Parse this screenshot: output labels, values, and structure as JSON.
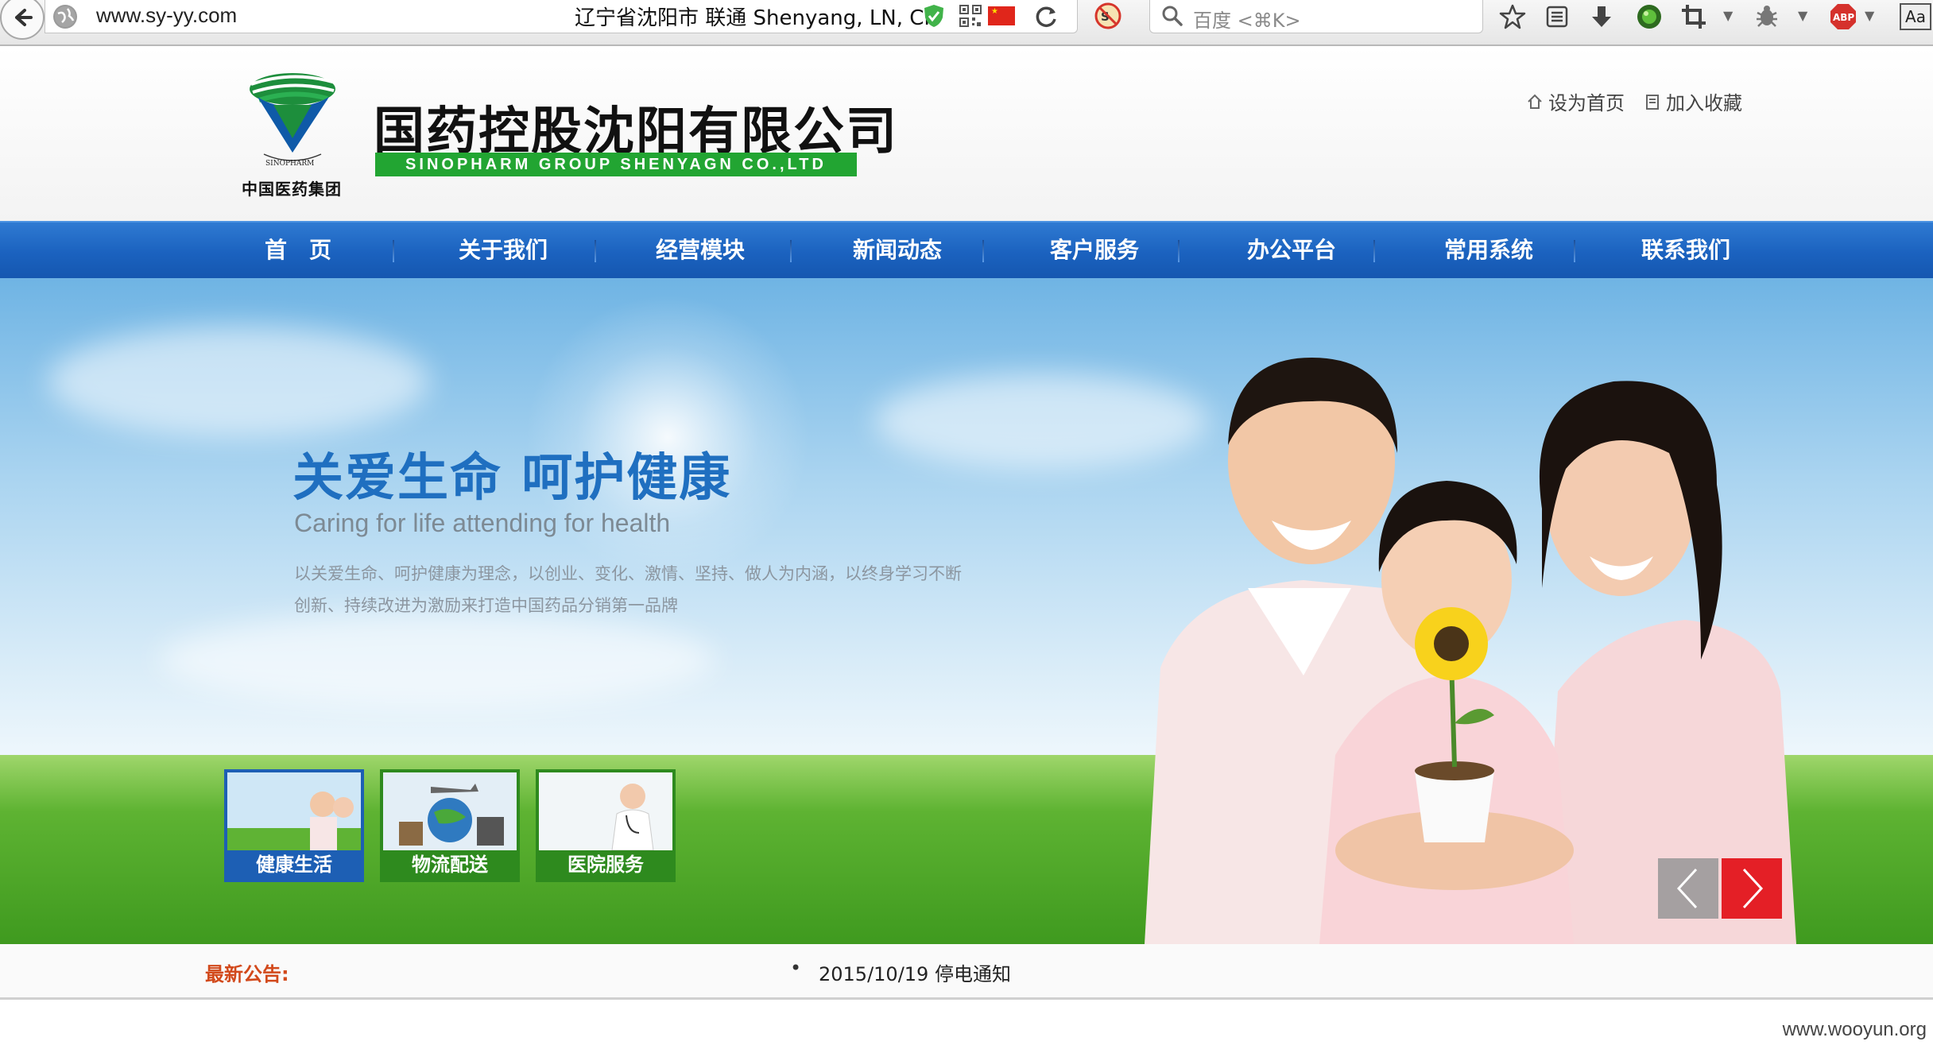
{
  "browser": {
    "url": "www.sy-yy.com",
    "geo_info": "辽宁省沈阳市 联通   Shenyang, LN, CN",
    "search_placeholder": "百度 <⌘K>",
    "icons": [
      "back-icon",
      "globe-icon",
      "shield-icon",
      "qr-code-icon",
      "china-flag-icon",
      "reload-icon",
      "noscript-icon",
      "search-icon",
      "bookmark-star-icon",
      "reader-icon",
      "download-icon",
      "green-orb-icon",
      "crop-icon",
      "bug-icon",
      "adblock-icon",
      "font-icon"
    ],
    "adblock_label": "ABP",
    "font_label": "Aa"
  },
  "header": {
    "logo_caption": "中国医药集团",
    "logo_ring_text": "SINOPHARM",
    "company_name": "国药控股沈阳有限公司",
    "company_name_en": "SINOPHARM GROUP SHENYAGN CO.,LTD",
    "links": [
      {
        "label": "设为首页",
        "icon": "home-icon"
      },
      {
        "label": "加入收藏",
        "icon": "favorite-icon"
      }
    ],
    "brand_color": "#22a532"
  },
  "nav": {
    "items": [
      {
        "label": "首　页"
      },
      {
        "label": "关于我们"
      },
      {
        "label": "经营模块"
      },
      {
        "label": "新闻动态"
      },
      {
        "label": "客户服务"
      },
      {
        "label": "办公平台"
      },
      {
        "label": "常用系统"
      },
      {
        "label": "联系我们"
      }
    ],
    "color": "#1b62bf"
  },
  "banner": {
    "title": "关爱生命  呵护健康",
    "subtitle": "Caring for life attending for health",
    "description": "以关爱生命、呵护健康为理念，以创业、变化、激情、坚持、做人为内涵，以终身学习不断创新、持续改进为激励来打造中国药品分销第一品牌",
    "thumbnails": [
      {
        "label": "健康生活",
        "active": true
      },
      {
        "label": "物流配送",
        "active": false
      },
      {
        "label": "医院服务",
        "active": false
      }
    ],
    "prev_icon": "chevron-left-icon",
    "next_icon": "chevron-right-icon",
    "title_color": "#1f6fc0"
  },
  "notice": {
    "label": "最新公告:",
    "items": [
      "2015/10/19 停电通知"
    ],
    "label_color": "#d2491b"
  },
  "watermark": "www.wooyun.org"
}
